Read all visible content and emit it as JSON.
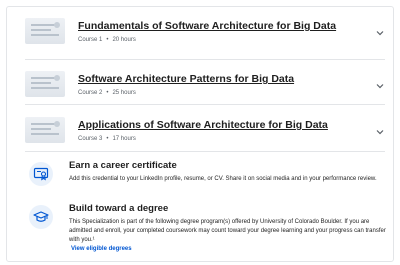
{
  "courses": [
    {
      "title": "Fundamentals of Software Architecture for Big Data",
      "number": "Course 1",
      "hours": "20 hours",
      "chevron_icon": "chevron-down-icon"
    },
    {
      "title": "Software Architecture Patterns for Big Data",
      "number": "Course 2",
      "hours": "25 hours",
      "chevron_icon": "chevron-down-icon"
    },
    {
      "title": "Applications of Software Architecture for Big Data",
      "number": "Course 3",
      "hours": "17 hours",
      "chevron_icon": "chevron-down-icon"
    }
  ],
  "meta_separator": "•",
  "career_certificate": {
    "icon": "certificate-icon",
    "title": "Earn a career certificate",
    "text": "Add this credential to your LinkedIn profile, resume, or CV. Share it on social media and in your performance review."
  },
  "degree": {
    "icon": "graduation-cap-icon",
    "title": "Build toward a degree",
    "text": "This Specialization is part of the following degree program(s) offered by University of Colorado Boulder. If you are admitted and enroll, your completed coursework may count toward your degree learning and your progress can transfer with you.¹",
    "link": "View eligible degrees"
  },
  "colors": {
    "link": "#0056d2",
    "icon_bg": "#e9f1fb",
    "divider": "#e3e5e8"
  }
}
